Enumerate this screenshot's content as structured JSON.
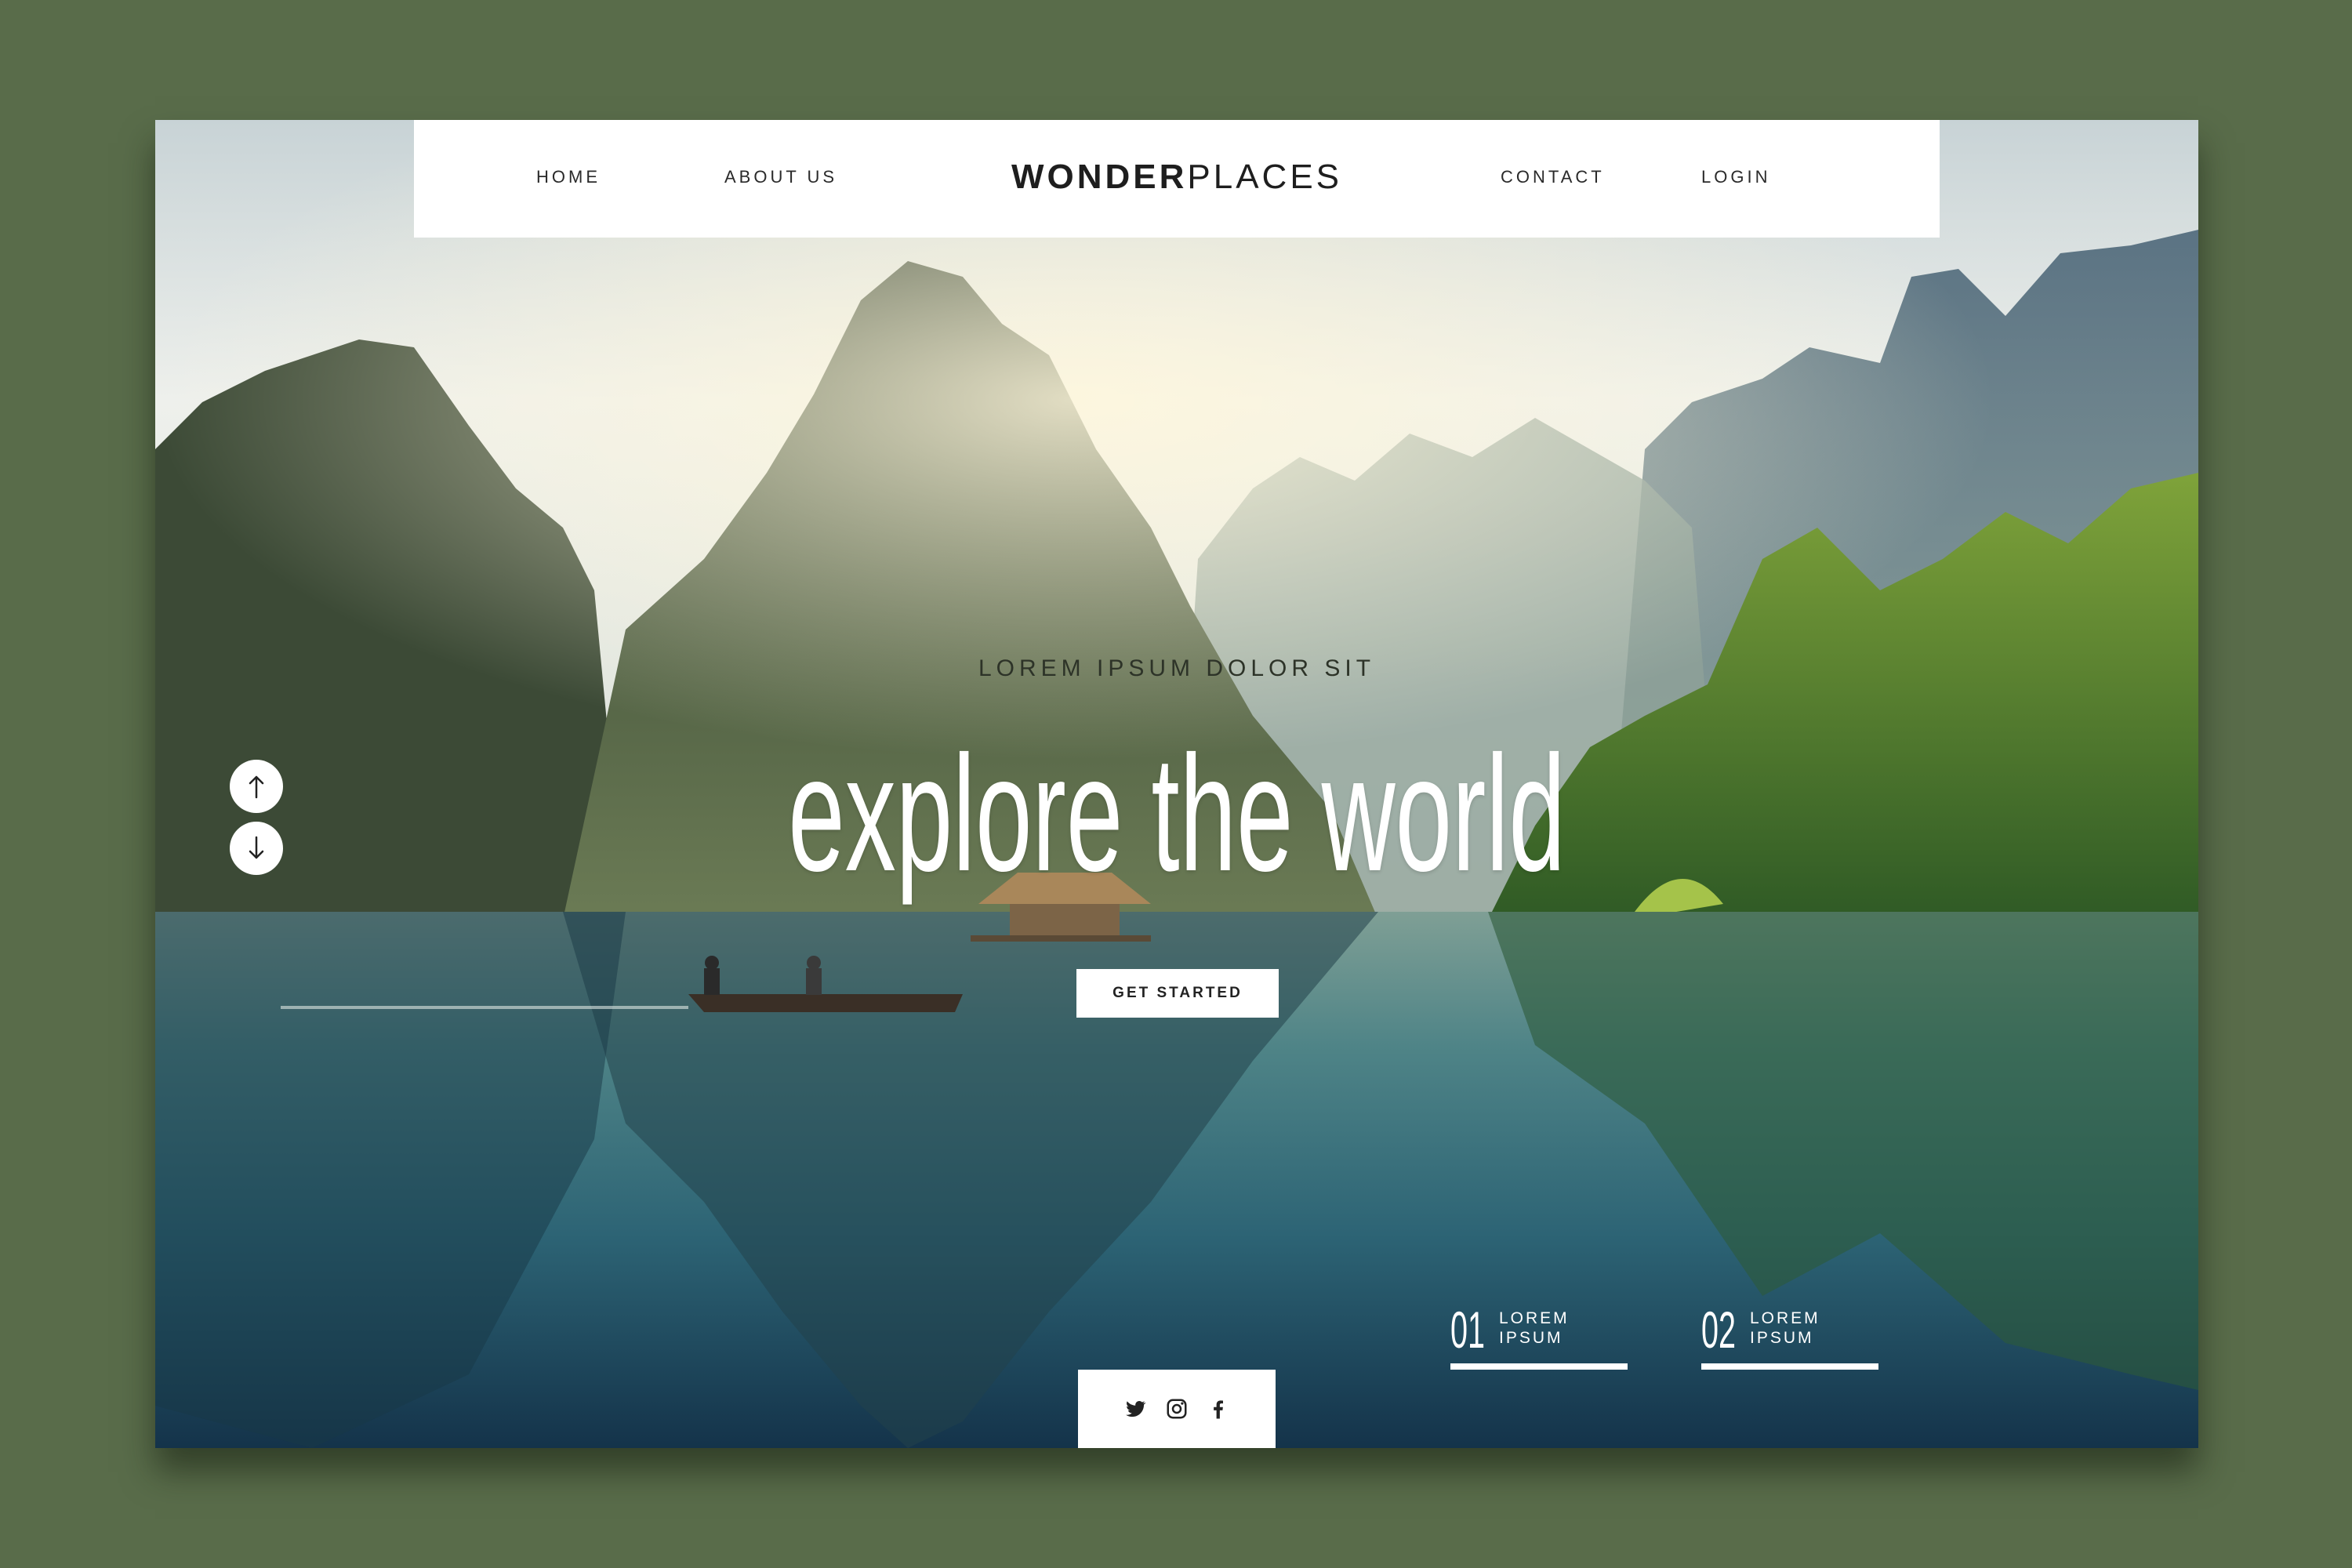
{
  "nav": {
    "left_items": [
      "HOME",
      "ABOUT US"
    ],
    "logo_bold": "WONDER",
    "logo_light": "PLACES",
    "right_items": [
      "CONTACT",
      "LOGIN"
    ]
  },
  "hero": {
    "subtitle": "LOREM IPSUM DOLOR SIT",
    "headline": "explore the world",
    "cta_label": "GET STARTED"
  },
  "scroll": {
    "up_icon": "arrow-up-icon",
    "down_icon": "arrow-down-icon"
  },
  "slides": [
    {
      "number": "01",
      "label": "LOREM IPSUM"
    },
    {
      "number": "02",
      "label": "LOREM IPSUM"
    }
  ],
  "social": [
    "twitter-icon",
    "instagram-icon",
    "facebook-icon"
  ],
  "colors": {
    "background": "#596c4a",
    "panel": "#ffffff",
    "text_dark": "#222222",
    "headline": "#ffffff"
  }
}
